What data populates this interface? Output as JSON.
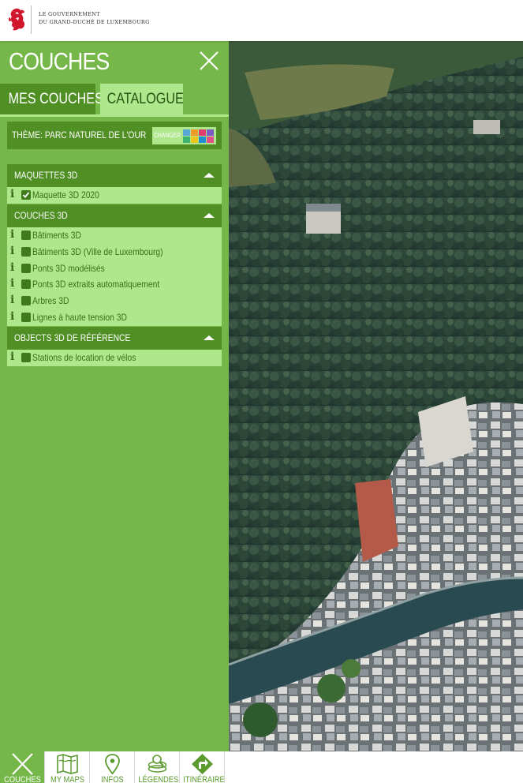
{
  "header": {
    "gov_line1": "LE GOUVERNEMENT",
    "gov_line2": "DU GRAND-DUCHÉ DE LUXEMBOURG",
    "logo_icon": "lion-icon",
    "logo_color": "#d0162b"
  },
  "panel": {
    "title": "COUCHES",
    "close_icon": "close-icon",
    "tabs": [
      {
        "label": "MES COUCHES",
        "active": false
      },
      {
        "label": "CATALOGUE",
        "active": true
      }
    ],
    "theme": {
      "label": "THÈME: PARC NATUREL DE L'OUR",
      "change_label": "CHANGER",
      "swatch_colors": [
        "#57a8d8",
        "#f09a2a",
        "#e23d6e",
        "#7c5cc4",
        "#3cb371",
        "#f2c419",
        "#1f8fd1",
        "#b4d64a"
      ]
    },
    "sections": [
      {
        "title": "MAQUETTES 3D",
        "expanded": true,
        "layers": [
          {
            "label": "Maquette 3D 2020",
            "checked": true
          }
        ]
      },
      {
        "title": "COUCHES 3D",
        "expanded": true,
        "layers": [
          {
            "label": "Bâtiments 3D",
            "checked": false
          },
          {
            "label": "Bâtiments 3D (Ville de Luxembourg)",
            "checked": false
          },
          {
            "label": "Ponts 3D modélisés",
            "checked": false
          },
          {
            "label": "Ponts 3D extraits automatiquement",
            "checked": false
          },
          {
            "label": "Arbres 3D",
            "checked": false
          },
          {
            "label": "Lignes à haute tension 3D",
            "checked": false
          }
        ]
      },
      {
        "title": "OBJECTS 3D DE RÉFÉRENCE",
        "expanded": true,
        "layers": [
          {
            "label": "Stations de location de vélos",
            "checked": false
          }
        ]
      }
    ]
  },
  "bottom_nav": [
    {
      "label": "COUCHES",
      "icon": "close-icon",
      "active": true
    },
    {
      "label": "MY MAPS",
      "icon": "map-icon",
      "active": false
    },
    {
      "label": "INFOS",
      "icon": "location-pin-icon",
      "active": false
    },
    {
      "label": "LÉGENDES",
      "icon": "legend-icon",
      "active": false
    },
    {
      "label": "ITINÉRAIRE",
      "icon": "route-arrow-icon",
      "active": false
    }
  ],
  "colors": {
    "panel_green": "#76b74a",
    "dark_green": "#4f8f24",
    "light_green": "#aee78c"
  }
}
